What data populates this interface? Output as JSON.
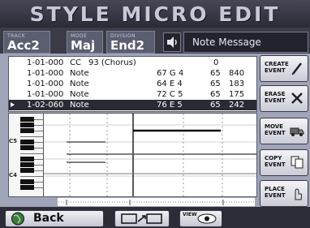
{
  "title": "STYLE MICRO EDIT",
  "info": {
    "track": {
      "label": "TRACK",
      "value": "Acc2"
    },
    "mode": {
      "label": "MODE",
      "value": "Maj"
    },
    "division": {
      "label": "DIVISION",
      "value": "End2"
    },
    "speaker_icon": "speaker-icon",
    "message": "Note Message"
  },
  "events": [
    {
      "pos": "1-01-000",
      "type": "CC",
      "detail": "93 (Chorus)",
      "note": "",
      "value": "0",
      "length": ""
    },
    {
      "pos": "1-01-000",
      "type": "Note",
      "detail": "",
      "note": "67 G 4",
      "value": "65",
      "length": "840"
    },
    {
      "pos": "1-01-000",
      "type": "Note",
      "detail": "",
      "note": "64 E 4",
      "value": "65",
      "length": "183"
    },
    {
      "pos": "1-01-000",
      "type": "Note",
      "detail": "",
      "note": "72 C 5",
      "value": "65",
      "length": "175"
    },
    {
      "pos": "1-02-060",
      "type": "Note",
      "detail": "",
      "note": "76 E 5",
      "value": "65",
      "length": "242"
    }
  ],
  "selected_event": 4,
  "piano_roll": {
    "labels": [
      "C5",
      "C4"
    ]
  },
  "side_buttons": [
    {
      "label": "CREATE\nEVENT",
      "icon": "pencil-icon"
    },
    {
      "label": "ERASE\nEVENT",
      "icon": "erase-x-icon"
    },
    {
      "label": "MOVE\nEVENT",
      "icon": "truck-icon"
    },
    {
      "label": "COPY\nEVENT",
      "icon": "copy-pages-icon"
    },
    {
      "label": "PLACE\nEVENT",
      "icon": "place-hand-icon"
    }
  ],
  "bottom": {
    "back_label": "Back",
    "zoom_icon": "zoom-expand-icon",
    "view_label": "VIEW",
    "view_icon": "eye-icon"
  }
}
